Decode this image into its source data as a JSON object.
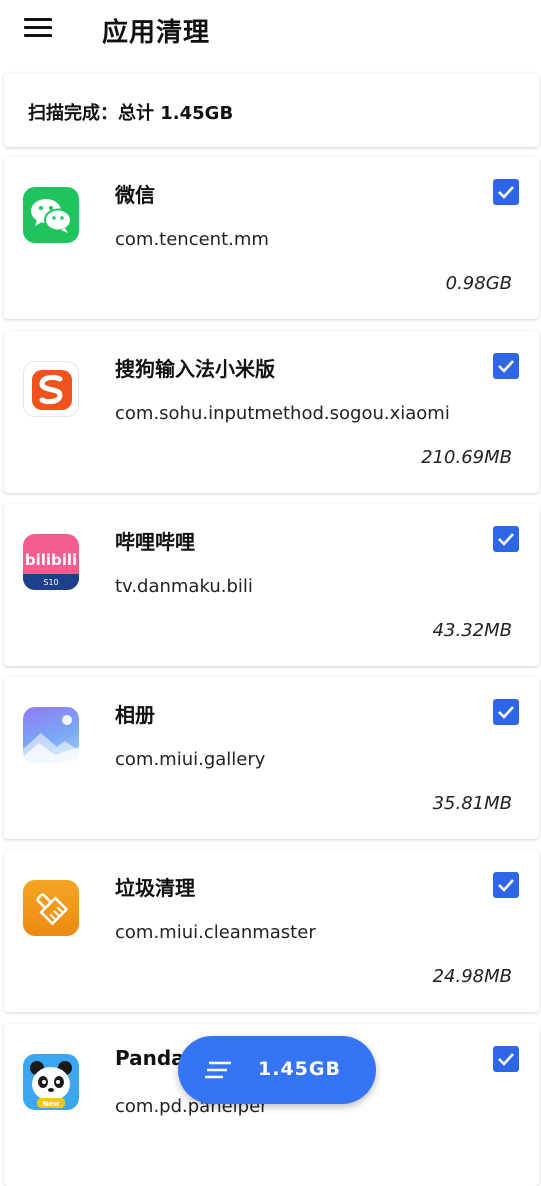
{
  "header": {
    "title": "应用清理",
    "menu_icon": "hamburger-menu-icon"
  },
  "summary": {
    "text": "扫描完成：总计 1.45GB"
  },
  "colors": {
    "accent": "#2f66e8",
    "fab": "#3574f2"
  },
  "apps": [
    {
      "name": "微信",
      "package": "com.tencent.mm",
      "size": "0.98GB",
      "icon": "wechat-icon",
      "checked": true
    },
    {
      "name": "搜狗输入法小米版",
      "package": "com.sohu.inputmethod.sogou.xiaomi",
      "size": "210.69MB",
      "icon": "sogou-icon",
      "checked": true
    },
    {
      "name": "哔哩哔哩",
      "package": "tv.danmaku.bili",
      "size": "43.32MB",
      "icon": "bilibili-icon",
      "checked": true
    },
    {
      "name": "相册",
      "package": "com.miui.gallery",
      "size": "35.81MB",
      "icon": "gallery-icon",
      "checked": true
    },
    {
      "name": "垃圾清理",
      "package": "com.miui.cleanmaster",
      "size": "24.98MB",
      "icon": "cleaner-icon",
      "checked": true
    },
    {
      "name": "Panda",
      "package": "com.pd.panelper",
      "size": "",
      "icon": "panda-icon",
      "checked": true
    }
  ],
  "fab": {
    "label": "1.45GB",
    "icon": "sort-lines-icon"
  }
}
